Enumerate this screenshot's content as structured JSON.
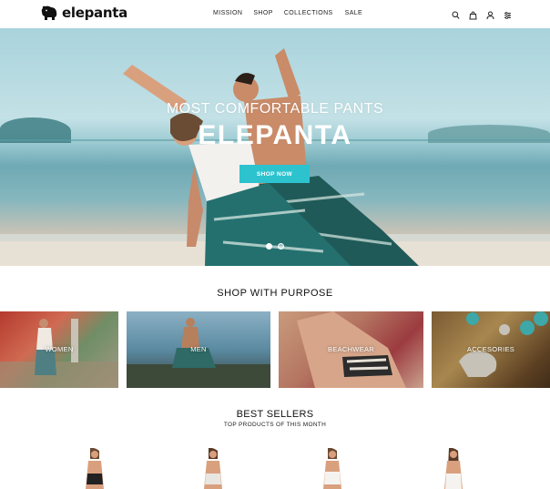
{
  "header": {
    "logo_text": "elepanta",
    "nav": [
      "MISSION",
      "SHOP",
      "COLLECTIONS",
      "SALE"
    ],
    "icons": [
      "search-icon",
      "bag-icon",
      "user-icon",
      "filter-icon"
    ]
  },
  "hero": {
    "subtitle": "MOST COMFORTABLE PANTS",
    "title": "ELEPANTA",
    "button": "SHOP NOW",
    "slides": 2,
    "active_slide": 1
  },
  "purpose": {
    "title": "SHOP WITH PURPOSE",
    "categories": [
      "WOMEN",
      "MEN",
      "BEACHWEAR",
      "ACCESORIES"
    ]
  },
  "best_sellers": {
    "title": "BEST SELLERS",
    "subtitle": "TOP PRODUCTS OF THIS MONTH"
  },
  "colors": {
    "accent": "#2cc3cf"
  }
}
